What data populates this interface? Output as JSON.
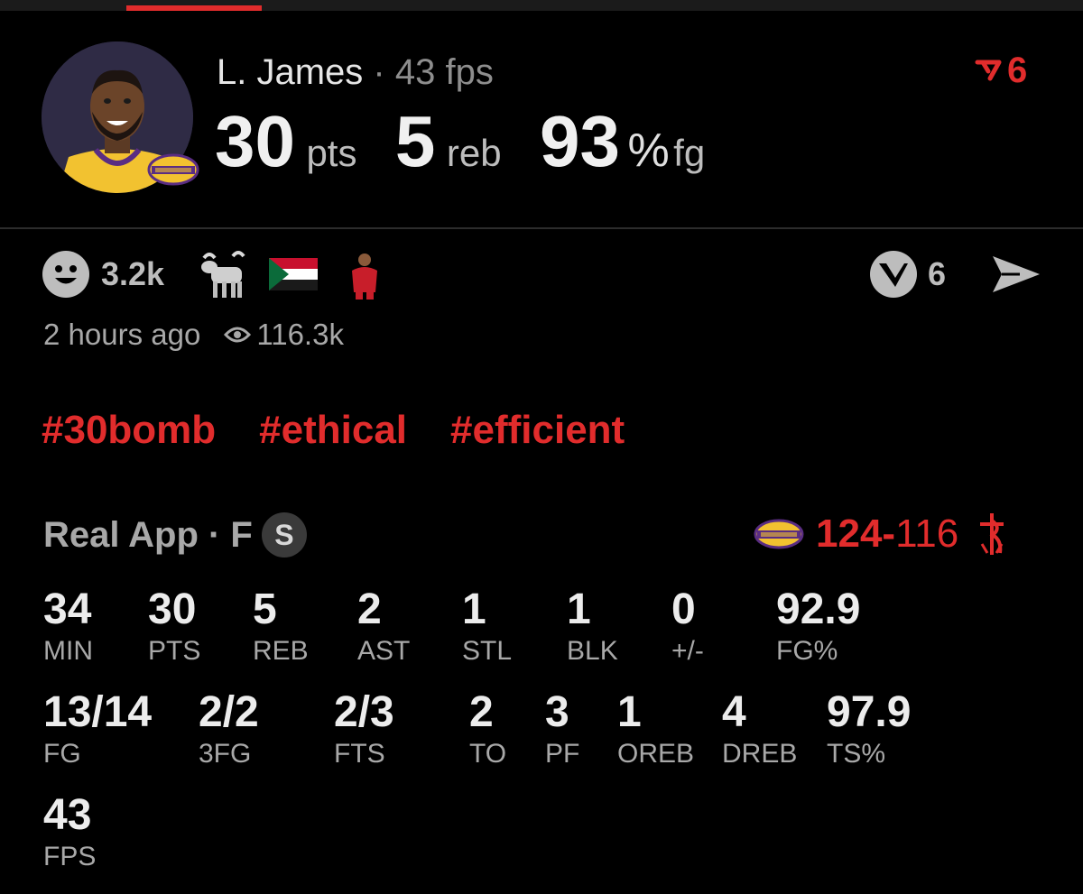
{
  "header": {
    "player_name": "L. James",
    "separator": "·",
    "fps_label": "43 fps",
    "pts_value": "30",
    "pts_unit": "pts",
    "reb_value": "5",
    "reb_unit": "reb",
    "fg_value": "93",
    "fg_percent": "%",
    "fg_unit": "fg",
    "top_reaction_count": "6",
    "accent_color": "#e12c2c"
  },
  "reactions": {
    "smiley_count": "3.2k",
    "icons": [
      "smiley-icon",
      "goat-icon",
      "sudan-flag-icon",
      "player-sticker-icon"
    ],
    "v_count": "6"
  },
  "meta": {
    "time_ago": "2 hours ago",
    "views": "116.3k"
  },
  "tags": [
    "#30bomb",
    "#ethical",
    "#efficient"
  ],
  "game": {
    "source": "Real App · F",
    "badge": "S",
    "team_score": "124",
    "dash": "-",
    "opp_score": "116"
  },
  "stats": [
    {
      "value": "34",
      "label": "MIN"
    },
    {
      "value": "30",
      "label": "PTS"
    },
    {
      "value": "5",
      "label": "REB"
    },
    {
      "value": "2",
      "label": "AST"
    },
    {
      "value": "1",
      "label": "STL"
    },
    {
      "value": "1",
      "label": "BLK"
    },
    {
      "value": "0",
      "label": "+/-"
    },
    {
      "value": "92.9",
      "label": "FG%"
    },
    {
      "value": "13/14",
      "label": "FG"
    },
    {
      "value": "2/2",
      "label": "3FG"
    },
    {
      "value": "2/3",
      "label": "FTS"
    },
    {
      "value": "2",
      "label": "TO"
    },
    {
      "value": "3",
      "label": "PF"
    },
    {
      "value": "1",
      "label": "OREB"
    },
    {
      "value": "4",
      "label": "DREB"
    },
    {
      "value": "97.9",
      "label": "TS%"
    },
    {
      "value": "43",
      "label": "FPS"
    }
  ]
}
